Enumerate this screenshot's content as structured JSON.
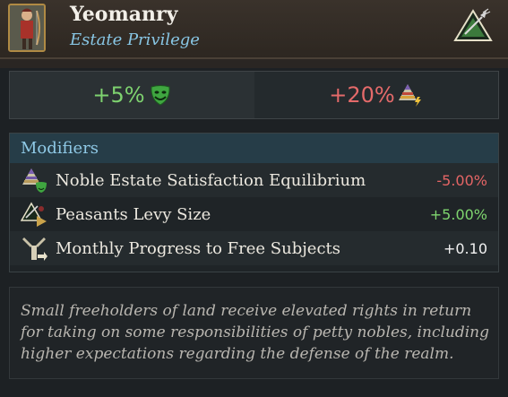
{
  "header": {
    "title": "Yeomanry",
    "subtitle": "Estate Privilege",
    "portrait_icon": "archer-portrait-icon",
    "estate_icon": "peasants-estate-icon"
  },
  "summary": {
    "satisfaction": "+5%",
    "satisfaction_icon": "happy-mask-icon",
    "power": "+20%",
    "power_icon": "estate-power-pyramid-icon"
  },
  "modifiers": {
    "heading": "Modifiers",
    "rows": [
      {
        "label": "Noble Estate Satisfaction Equilibrium",
        "value": "-5.00%",
        "icon": "noble-estate-satisfaction-icon",
        "tone": "negative"
      },
      {
        "label": "Peasants Levy Size",
        "value": "+5.00%",
        "icon": "peasants-levy-icon",
        "tone": "positive"
      },
      {
        "label": "Monthly Progress to Free Subjects",
        "value": "+0.10",
        "icon": "free-subjects-icon",
        "tone": "neutral"
      }
    ]
  },
  "description": "Small freeholders of land receive elevated rights in return for taking on some responsibilities of petty nobles, including higher expectations regarding the defense of the realm.",
  "colors": {
    "positive": "#7fd66f",
    "negative": "#e46565",
    "accent": "#88c6e4"
  }
}
